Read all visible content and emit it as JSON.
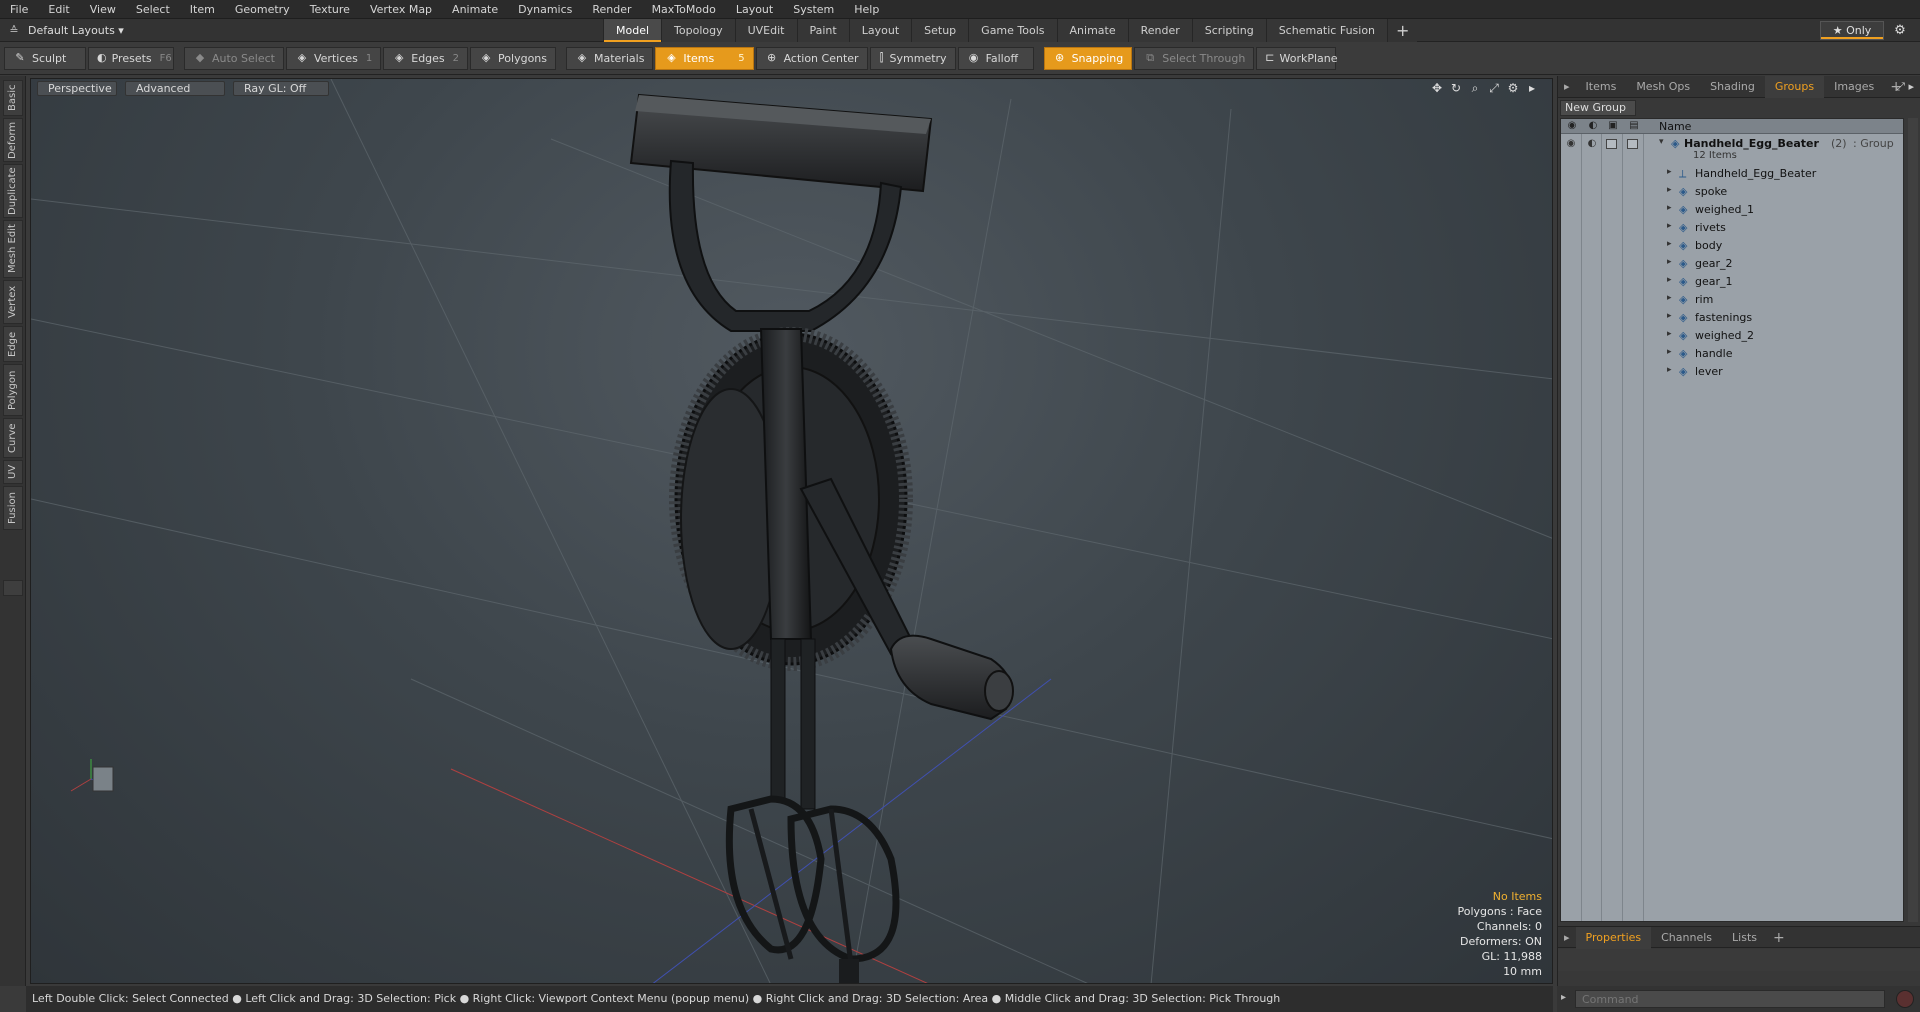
{
  "menu": [
    "File",
    "Edit",
    "View",
    "Select",
    "Item",
    "Geometry",
    "Texture",
    "Vertex Map",
    "Animate",
    "Dynamics",
    "Render",
    "MaxToModo",
    "Layout",
    "System",
    "Help"
  ],
  "layouts": {
    "selector": "Default Layouts ▾",
    "tabs": [
      "Model",
      "Topology",
      "UVEdit",
      "Paint",
      "Layout",
      "Setup",
      "Game Tools",
      "Animate",
      "Render",
      "Scripting",
      "Schematic Fusion"
    ],
    "active_tab": "Model",
    "add_label": "+",
    "only_label": "★ Only"
  },
  "toolbar": {
    "sculpt": "Sculpt",
    "presets": "Presets",
    "presets_key": "F6",
    "auto_select": "Auto Select",
    "vertices": "Vertices",
    "vertices_count": "1",
    "edges": "Edges",
    "edges_count": "2",
    "polygons": "Polygons",
    "materials": "Materials",
    "items": "Items",
    "items_count": "5",
    "action_center": "Action Center",
    "symmetry": "Symmetry",
    "falloff": "Falloff",
    "snapping": "Snapping",
    "select_through": "Select Through",
    "workplane": "WorkPlane"
  },
  "left_tabs": [
    "Basic",
    "Deform",
    "Duplicate",
    "Mesh Edit",
    "Vertex",
    "Edge",
    "Polygon",
    "Curve",
    "UV",
    "Fusion"
  ],
  "viewport": {
    "view": "Perspective",
    "shading": "Advanced",
    "raygl": "Ray GL: Off",
    "info": {
      "selection": "No Items",
      "polygons": "Polygons : Face",
      "channels": "Channels: 0",
      "deformers": "Deformers: ON",
      "gl": "GL: 11,988",
      "units": "10 mm"
    }
  },
  "right_panel": {
    "tabs": [
      "Items",
      "Mesh Ops",
      "Shading",
      "Groups",
      "Images"
    ],
    "active_tab": "Groups",
    "new_group": "New Group",
    "column_name": "Name",
    "group": {
      "name": "Handheld_Egg_Beater",
      "count": "(2)",
      "type": ": Group",
      "items_label": "12 Items"
    },
    "items": [
      "Handheld_Egg_Beater",
      "spoke",
      "weighed_1",
      "rivets",
      "body",
      "gear_2",
      "gear_1",
      "rim",
      "fastenings",
      "weighed_2",
      "handle",
      "lever"
    ],
    "bottom_tabs": [
      "Properties",
      "Channels",
      "Lists"
    ],
    "bottom_active": "Properties"
  },
  "status": "Left Double Click: Select Connected ● Left Click and Drag: 3D Selection: Pick ● Right Click: Viewport Context Menu (popup menu) ● Right Click and Drag: 3D Selection: Area ● Middle Click and Drag: 3D Selection: Pick Through",
  "command": {
    "placeholder": "Command"
  },
  "colors": {
    "accent": "#e69a1c",
    "tree_bg": "#9aa1a8",
    "viewport_bg": "#3e464c"
  }
}
